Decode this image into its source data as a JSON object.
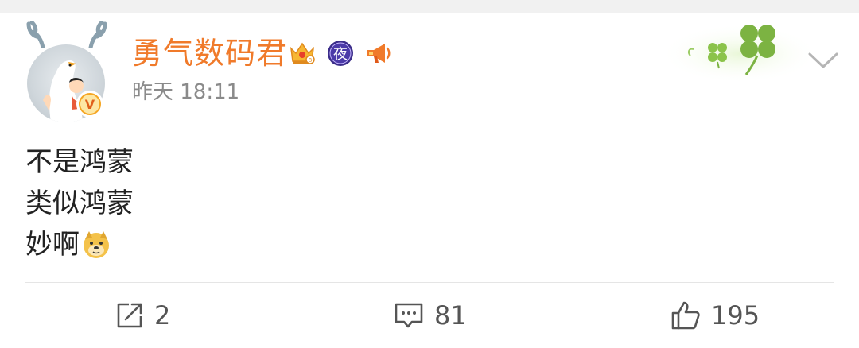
{
  "post": {
    "author": {
      "name": "勇气数码君",
      "verified": true,
      "badges": [
        {
          "icon": "crown-vip-icon",
          "color": "#f5a623"
        },
        {
          "icon": "night-badge-icon",
          "label": "夜",
          "color": "#3b2d8a"
        },
        {
          "icon": "megaphone-icon",
          "color": "#f07a2a"
        }
      ],
      "accent_color": "#f07a2a"
    },
    "timestamp": "昨天 18:11",
    "content_lines": [
      "不是鸿蒙",
      "类似鸿蒙",
      "妙啊"
    ],
    "content_emoji": "doge-emoji-icon",
    "decoration": "four-leaf-clover-icon",
    "menu_icon": "chevron-down-icon"
  },
  "actions": {
    "repost": {
      "icon": "repost-icon",
      "count": "2"
    },
    "comment": {
      "icon": "comment-icon",
      "count": "81"
    },
    "like": {
      "icon": "thumbs-up-icon",
      "count": "195"
    }
  }
}
